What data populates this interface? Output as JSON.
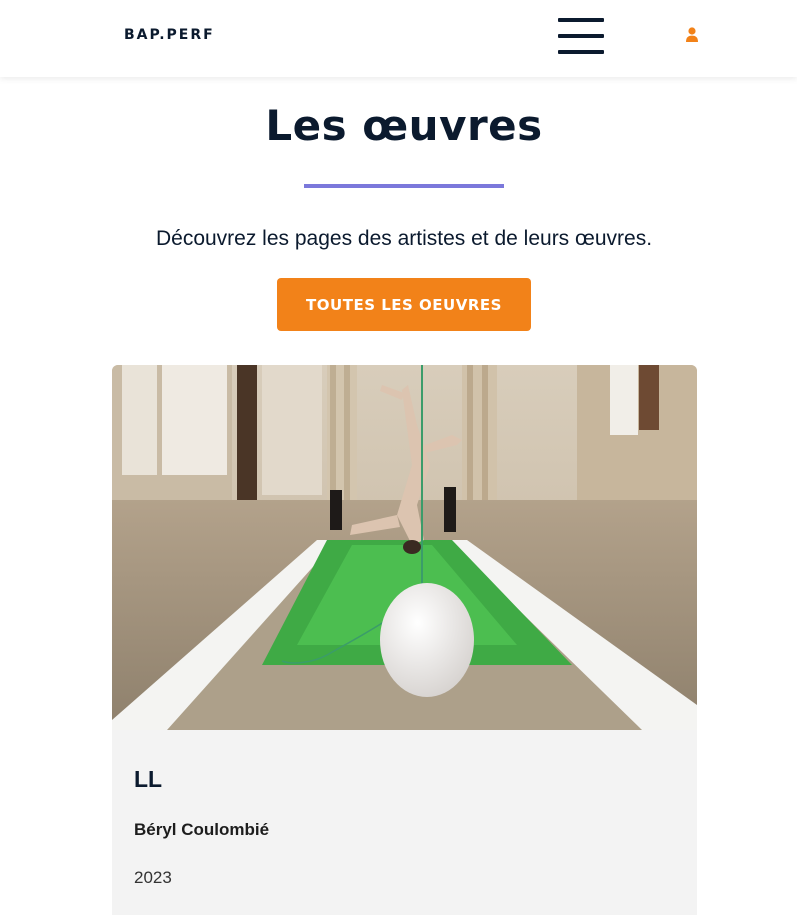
{
  "header": {
    "logo": "BAP.PERF",
    "menu_icon": "hamburger-menu-icon",
    "account_icon": "user-icon"
  },
  "main": {
    "title": "Les œuvres",
    "intro": "Découvrez les pages des artistes et de leurs œuvres.",
    "cta_label": "TOUTES LES OEUVRES"
  },
  "artworks": [
    {
      "title": "LL",
      "artist": "Béryl Coulombié",
      "year": "2023"
    }
  ],
  "colors": {
    "accent_orange": "#f28219",
    "title_rule_purple": "#7b78db",
    "text_dark": "#0b1a2e",
    "card_background": "#f3f3f3"
  }
}
